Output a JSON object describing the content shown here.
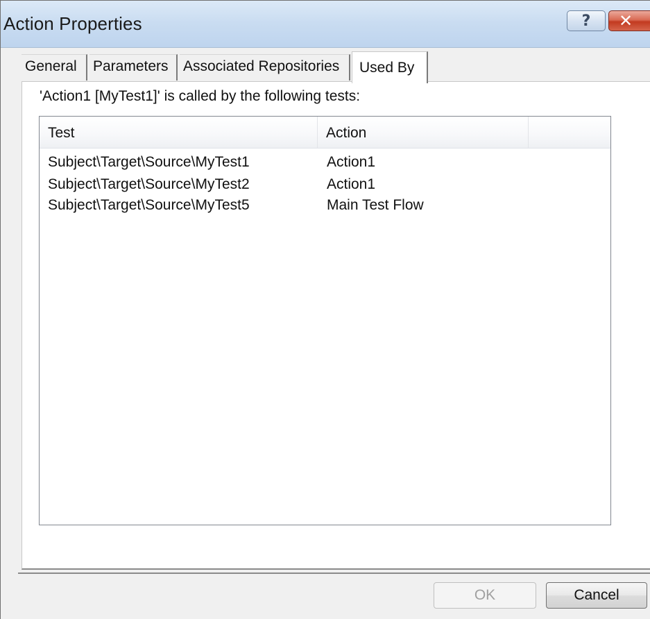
{
  "window": {
    "title": "Action Properties",
    "help_glyph": "?",
    "close_glyph": "✕"
  },
  "tabs": [
    {
      "label": "General",
      "active": false
    },
    {
      "label": "Parameters",
      "active": false
    },
    {
      "label": "Associated Repositories",
      "active": false
    },
    {
      "label": "Used By",
      "active": true
    }
  ],
  "used_by": {
    "caption": "'Action1 [MyTest1]' is called by the following tests:",
    "columns": [
      "Test",
      "Action",
      ""
    ],
    "rows": [
      {
        "test": "Subject\\Target\\Source\\MyTest1",
        "action": "Action1"
      },
      {
        "test": "Subject\\Target\\Source\\MyTest2",
        "action": "Action1"
      },
      {
        "test": "Subject\\Target\\Source\\MyTest5",
        "action": "Main Test Flow"
      }
    ]
  },
  "buttons": {
    "ok_label": "OK",
    "ok_enabled": false,
    "cancel_label": "Cancel"
  },
  "icons": {
    "help": "help-question-icon",
    "close": "close-icon"
  },
  "colors": {
    "titlebar": "#c9dcf1",
    "close_button": "#c23a20",
    "window_bg": "#f0f0f0"
  }
}
